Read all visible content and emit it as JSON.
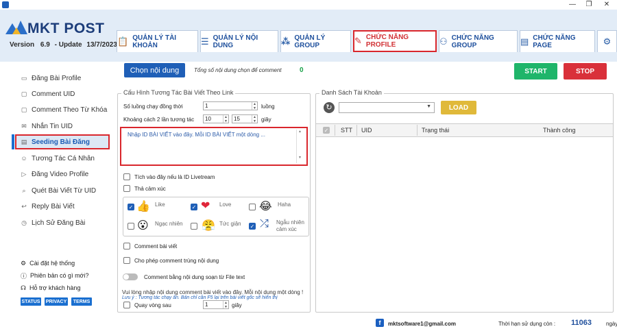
{
  "app": {
    "logo": "MKT POST",
    "version_label": "Version",
    "version": "6.9",
    "update_label": "- Update",
    "update_date": "13/7/2023"
  },
  "window_controls": {
    "minimize": "—",
    "restore": "❐",
    "close": "✕"
  },
  "tabs": [
    {
      "label": "QUẢN LÝ TÀI KHOẢN",
      "icon": "clipboard-icon"
    },
    {
      "label": "QUẢN LÝ NỘI DUNG",
      "icon": "list-icon"
    },
    {
      "label": "QUẢN LÝ GROUP",
      "icon": "group-icon"
    },
    {
      "label": "CHỨC NĂNG PROFILE",
      "icon": "edit-icon",
      "active": true
    },
    {
      "label": "CHỨC NĂNG GROUP",
      "icon": "people-icon"
    },
    {
      "label": "CHỨC NĂNG PAGE",
      "icon": "document-icon"
    }
  ],
  "sidebar": {
    "items": [
      {
        "label": "Đăng Bài Profile"
      },
      {
        "label": "Comment UID"
      },
      {
        "label": "Comment Theo Từ Khóa"
      },
      {
        "label": "Nhắn Tin UID"
      },
      {
        "label": "Seeding Bài Đăng",
        "active": true
      },
      {
        "label": "Tương Tác Cá Nhân"
      },
      {
        "label": "Đăng Video Profile"
      },
      {
        "label": "Quét Bài Viết Từ UID"
      },
      {
        "label": "Reply Bài Viết"
      },
      {
        "label": "Lịch Sử Đăng Bài"
      }
    ],
    "settings": [
      {
        "label": "Cài đặt hệ thống"
      },
      {
        "label": "Phiên bản có gì mới?"
      },
      {
        "label": "Hỗ trợ khách hàng"
      }
    ],
    "badges": [
      "STATUS",
      "PRIVACY",
      "TERMS"
    ]
  },
  "toolbar": {
    "choose_content": "Chọn nội dung",
    "total_content_note": "Tổng số nội dung chọn để comment",
    "total_count": "0",
    "start": "START",
    "stop": "STOP"
  },
  "config": {
    "legend": "Cấu Hình Tương Tác Bài Viết Theo Link",
    "threads_label": "Số luồng chạy đồng thời",
    "threads_value": "1",
    "threads_unit": "luồng",
    "interval_label": "Khoảng cách 2 lần tương tác",
    "interval_from": "10",
    "interval_to": "15",
    "interval_unit": "giây",
    "post_id_placeholder": "Nhập ID BÀI VIẾT vào đây. Mỗi ID BÀI VIẾT một dòng ...",
    "livestream_label": "Tích vào đây nếu là ID Livetream",
    "emotion_label": "Thả cảm xúc",
    "reactions": [
      {
        "label": "Like",
        "checked": true
      },
      {
        "label": "Love",
        "checked": true
      },
      {
        "label": "Haha",
        "checked": false
      },
      {
        "label": "Ngạc nhiên",
        "checked": false
      },
      {
        "label": "Tức giận",
        "checked": false
      },
      {
        "label": "Ngẫu nhiên cảm xúc",
        "checked": true
      }
    ],
    "comment_label": "Comment bài viết",
    "allow_dup_label": "Cho phép comment trùng nội dung",
    "comment_file_label": "Comment bằng nội dung soạn từ File text",
    "info_text": "Vui lòng nhập nội dung comment bài viết vào đây. Mỗi nội dung một dòng !",
    "hint_text": "Lưu ý : Tương tác chạy ẩn. Bản chỉ cần F5 lại trên bài viết gốc sẽ hiển thị",
    "loop_label": "Quay vòng sau",
    "loop_value": "1",
    "loop_unit": "giây"
  },
  "accounts": {
    "legend": "Danh Sách Tài Khoản",
    "load": "LOAD",
    "columns": [
      "STT",
      "UID",
      "Trạng thái",
      "Thành công"
    ]
  },
  "footer": {
    "email": "mktsoftware1@gmail.com",
    "expiry_label": "Thời hạn sử dụng còn :",
    "days": "11063",
    "unit": "ngày"
  }
}
